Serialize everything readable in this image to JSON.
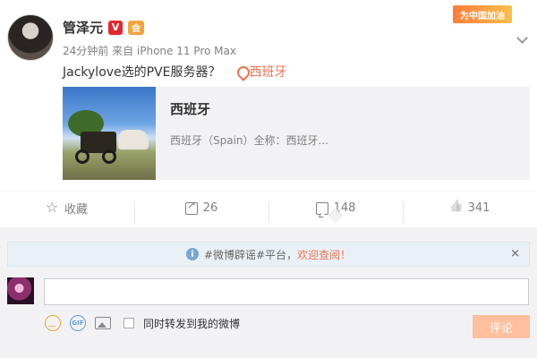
{
  "post": {
    "author": "管泽元",
    "verified_badge": "V",
    "member_badge": "会",
    "meta": "24分钟前 来自 iPhone 11 Pro Max",
    "text": "Jackylove选的PVE服务器？",
    "location": "西班牙"
  },
  "promo_badge": "为中国加油",
  "card": {
    "title": "西班牙",
    "description": "西班牙（Spain）全称：西班牙..."
  },
  "actions": {
    "favorite_label": "收藏",
    "share_count": "26",
    "comment_count": "148",
    "like_count": "341"
  },
  "comment_box": {
    "notice_prefix": "#微博辟谣#平台，",
    "notice_link": "欢迎查阅！",
    "notice_close": "×",
    "input_value": "",
    "gif_label": "GIF",
    "forward_label": "同时转发到我的微博",
    "submit_label": "评论"
  },
  "colors": {
    "accent": "#eb7350",
    "submit_disabled": "#ffc09f",
    "comment_bg": "#f2f2f5",
    "notice_bg": "#eaf1f6"
  },
  "icons": [
    "pin-icon",
    "star-icon",
    "share-icon",
    "comment-icon",
    "like-icon",
    "info-icon",
    "emoji-icon",
    "gif-icon",
    "image-icon",
    "chevron-down-icon"
  ]
}
